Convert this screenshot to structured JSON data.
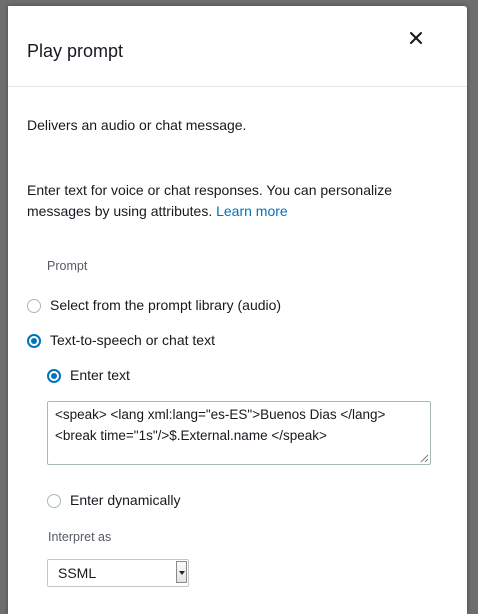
{
  "panel": {
    "title": "Play prompt",
    "description": "Delivers an audio or chat message.",
    "help_text": "Enter text for voice or chat responses. You can personalize messages by using attributes.",
    "learn_more": "Learn more"
  },
  "prompt": {
    "section_label": "Prompt",
    "option_library": "Select from the prompt library (audio)",
    "option_tts": "Text-to-speech or chat text",
    "option_enter_text": "Enter text",
    "text_value": "<speak> <lang xml:lang=\"es-ES\">Buenos Dias </lang>\n<break time=\"1s\"/>$.External.name </speak>",
    "option_enter_dynamically": "Enter dynamically",
    "interpret_label": "Interpret as",
    "interpret_value": "SSML"
  },
  "colors": {
    "accent": "#0073bb",
    "text": "#16191f",
    "muted": "#545b64",
    "backdrop": "#6e6e6e"
  },
  "icons": {
    "close": "close-icon",
    "select_arrow": "chevron-down-icon"
  }
}
